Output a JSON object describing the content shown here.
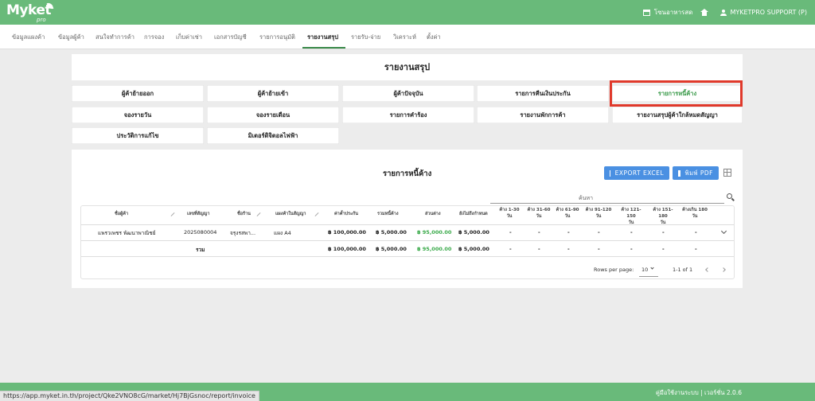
{
  "app": {
    "logo": "Myket",
    "logo_sub": "pro",
    "store_name": "โซนอาหารสด",
    "user_name": "MYKETPRO SUPPORT (P)"
  },
  "nav": {
    "tabs": [
      "ข้อมูลแผงค้า",
      "ข้อมูลผู้ค้า",
      "สนใจทำการค้า",
      "การจอง",
      "เก็บค่าเช่า",
      "เอกสารบัญชี",
      "รายการอนุมัติ",
      "รายงานสรุป",
      "รายรับ-จ่าย",
      "วิเคราะห์",
      "ตั้งค่า"
    ],
    "active": "รายงานสรุป"
  },
  "page": {
    "title": "รายงานสรุป"
  },
  "report_buttons": [
    "ผู้ค้าย้ายออก",
    "ผู้ค้าย้ายเข้า",
    "ผู้ค้าปัจจุบัน",
    "รายการคืนเงินประกัน",
    "รายการหนี้ค้าง",
    "จองรายวัน",
    "จองรายเดือน",
    "รายการคำร้อง",
    "รายงานพักการค้า",
    "รายงานสรุปผู้ค้าใกล้หมดสัญญา",
    "ประวัติการแก้ไข",
    "มิเตอร์ดิจิตอลไฟฟ้า"
  ],
  "selected_report": "รายการหนี้ค้าง",
  "section": {
    "title": "รายการหนี้ค้าง",
    "export_excel": "EXPORT EXCEL",
    "print_pdf": "พิมพ์ PDF",
    "search_placeholder": "ค้นหา"
  },
  "table": {
    "headers": {
      "name": "ชื่อผู้ค้า",
      "contract_no": "เลขที่สัญญา",
      "shop_name": "ชื่อร้าน",
      "stall_type": "แผงค้าในสัญญา",
      "deposit": "ค่าค้ำประกัน",
      "total_debt": "รวมหนี้ค้าง",
      "diff": "ส่วนต่าง",
      "not_due": "ยังไม่ถึงกำหนด",
      "d1_30": [
        "ค้าง 1-30",
        "วัน"
      ],
      "d31_60": [
        "ค้าง 31-60",
        "วัน"
      ],
      "d61_90": [
        "ค้าง 61-90",
        "วัน"
      ],
      "d91_120": [
        "ค้าง 91-120",
        "วัน"
      ],
      "d121_150": [
        "ค้าง 121-150",
        "วัน"
      ],
      "d151_180": [
        "ค้าง 151-180",
        "วัน"
      ],
      "d180p": [
        "ค้างเกิน 180",
        "วัน"
      ]
    },
    "row": {
      "name": "แพรวเพชร พัฒนาพาณิชย์",
      "contract_no": "2025080004",
      "shop_name": "จรุงรสพา...",
      "stall_type": "แผง A4",
      "deposit": "฿ 100,000.00",
      "total_debt": "฿ 5,000.00",
      "diff": "฿ 95,000.00",
      "not_due": "฿ 5,000.00",
      "dash": "-"
    },
    "total": {
      "label": "รวม",
      "deposit": "฿ 100,000.00",
      "total_debt": "฿ 5,000.00",
      "diff": "฿ 95,000.00",
      "not_due": "฿ 5,000.00",
      "dash": "-"
    },
    "pagination": {
      "rows_label": "Rows per page:",
      "rows_value": "10",
      "range": "1-1 of 1"
    }
  },
  "footer": {
    "text": "คู่มือใช้งานระบบ | เวอร์ชั่น 2.0.6"
  },
  "status_url": "https://app.myket.in.th/project/Qke2VNO8cG/market/Hj7BjGsnoc/report/invoice",
  "colors": {
    "brand": "#69ba7a",
    "accent_blue": "#4a90e2",
    "positive": "#3aaa4a",
    "highlight": "#e0392b"
  }
}
